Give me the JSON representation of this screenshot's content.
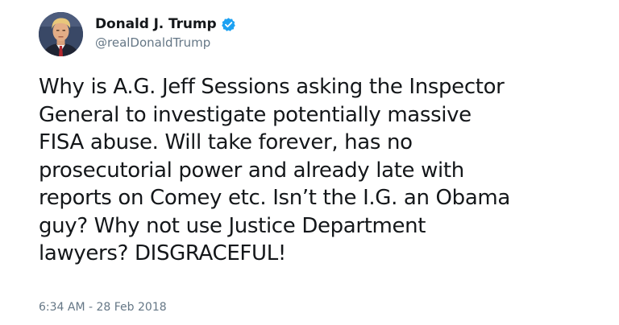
{
  "tweet": {
    "author": {
      "display_name": "Donald J. Trump",
      "handle": "@realDonaldTrump",
      "verified": true,
      "verified_icon": "verified-badge-icon",
      "verified_color": "#1da1f2"
    },
    "text": "Why is A.G. Jeff Sessions asking the Inspector\nGeneral to investigate potentially massive\nFISA abuse. Will take forever, has no\nprosecutorial power and already late with\nreports on Comey etc. Isn’t the I.G. an Obama\nguy? Why not use Justice Department\nlawyers? DISGRACEFUL!",
    "timestamp": "6:34 AM - 28 Feb 2018"
  }
}
